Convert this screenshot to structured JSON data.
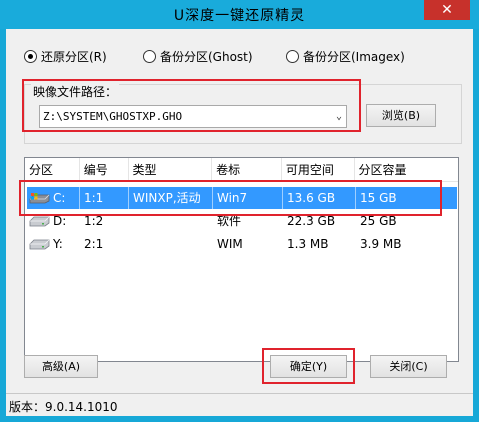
{
  "window": {
    "title": "U深度一键还原精灵",
    "close_label": "✕"
  },
  "mode": {
    "options": [
      {
        "label": "还原分区(R)",
        "checked": true
      },
      {
        "label": "备份分区(Ghost)",
        "checked": false
      },
      {
        "label": "备份分区(Imagex)",
        "checked": false
      }
    ]
  },
  "image_path": {
    "label": "映像文件路径：",
    "value": "Z:\\SYSTEM\\GHOSTXP.GHO",
    "browse_label": "浏览(B)"
  },
  "partitions": {
    "columns": [
      "分区",
      "编号",
      "类型",
      "卷标",
      "可用空间",
      "分区容量"
    ],
    "rows": [
      {
        "drive": "C:",
        "num": "1:1",
        "type": "WINXP,活动",
        "label": "Win7",
        "free": "13.6 GB",
        "size": "15 GB",
        "selected": true,
        "icon": "windows-drive-icon"
      },
      {
        "drive": "D:",
        "num": "1:2",
        "type": "",
        "label": "软件",
        "free": "22.3 GB",
        "size": "25 GB",
        "selected": false,
        "icon": "drive-icon"
      },
      {
        "drive": "Y:",
        "num": "2:1",
        "type": "",
        "label": "WIM",
        "free": "1.3 MB",
        "size": "3.9 MB",
        "selected": false,
        "icon": "drive-icon"
      }
    ]
  },
  "buttons": {
    "advanced": "高级(A)",
    "ok": "确定(Y)",
    "close": "关闭(C)"
  },
  "status": {
    "version": "版本：9.0.14.1010"
  },
  "colors": {
    "titlebar": "#19abdb",
    "close_button": "#c7312b",
    "selection": "#3399ff",
    "highlight_box": "#e0232d"
  }
}
